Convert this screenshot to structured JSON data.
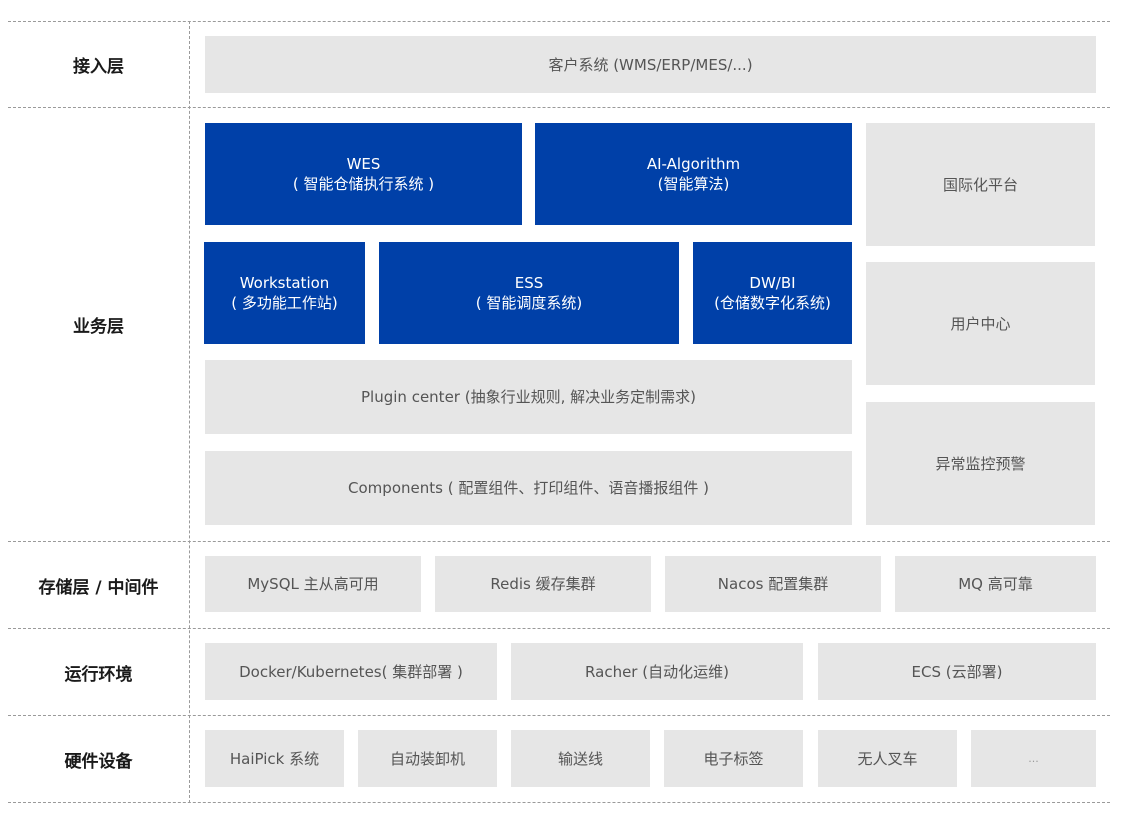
{
  "layers": {
    "access": "接入层",
    "business": "业务层",
    "storage": "存储层 / 中间件",
    "runtime": "运行环境",
    "hardware": "硬件设备"
  },
  "access": {
    "client": "客户系统 (WMS/ERP/MES/...)"
  },
  "business": {
    "wes": {
      "title": "WES",
      "subtitle": "( 智能仓储执行系统 )"
    },
    "ai": {
      "title": "AI-Algorithm",
      "subtitle": "(智能算法)"
    },
    "workstation": {
      "title": "Workstation",
      "subtitle": "( 多功能工作站)"
    },
    "ess": {
      "title": "ESS",
      "subtitle": "( 智能调度系统)"
    },
    "dwbi": {
      "title": "DW/BI",
      "subtitle": "(仓储数字化系统)"
    },
    "plugin": "Plugin center (抽象行业规则, 解决业务定制需求)",
    "components": "Components ( 配置组件、打印组件、语音播报组件 )",
    "side": [
      "国际化平台",
      "用户中心",
      "异常监控预警"
    ]
  },
  "storage": {
    "items": [
      "MySQL 主从高可用",
      "Redis 缓存集群",
      "Nacos 配置集群",
      "MQ 高可靠"
    ]
  },
  "runtime": {
    "items": [
      "Docker/Kubernetes( 集群部署 )",
      "Racher (自动化运维)",
      "ECS (云部署)"
    ]
  },
  "hardware": {
    "items": [
      "HaiPick 系统",
      "自动装卸机",
      "输送线",
      "电子标签",
      "无人叉车",
      "..."
    ]
  },
  "colors": {
    "primary_blue": "#0040a8",
    "box_gray": "#e6e6e6",
    "text_gray": "#555555"
  }
}
